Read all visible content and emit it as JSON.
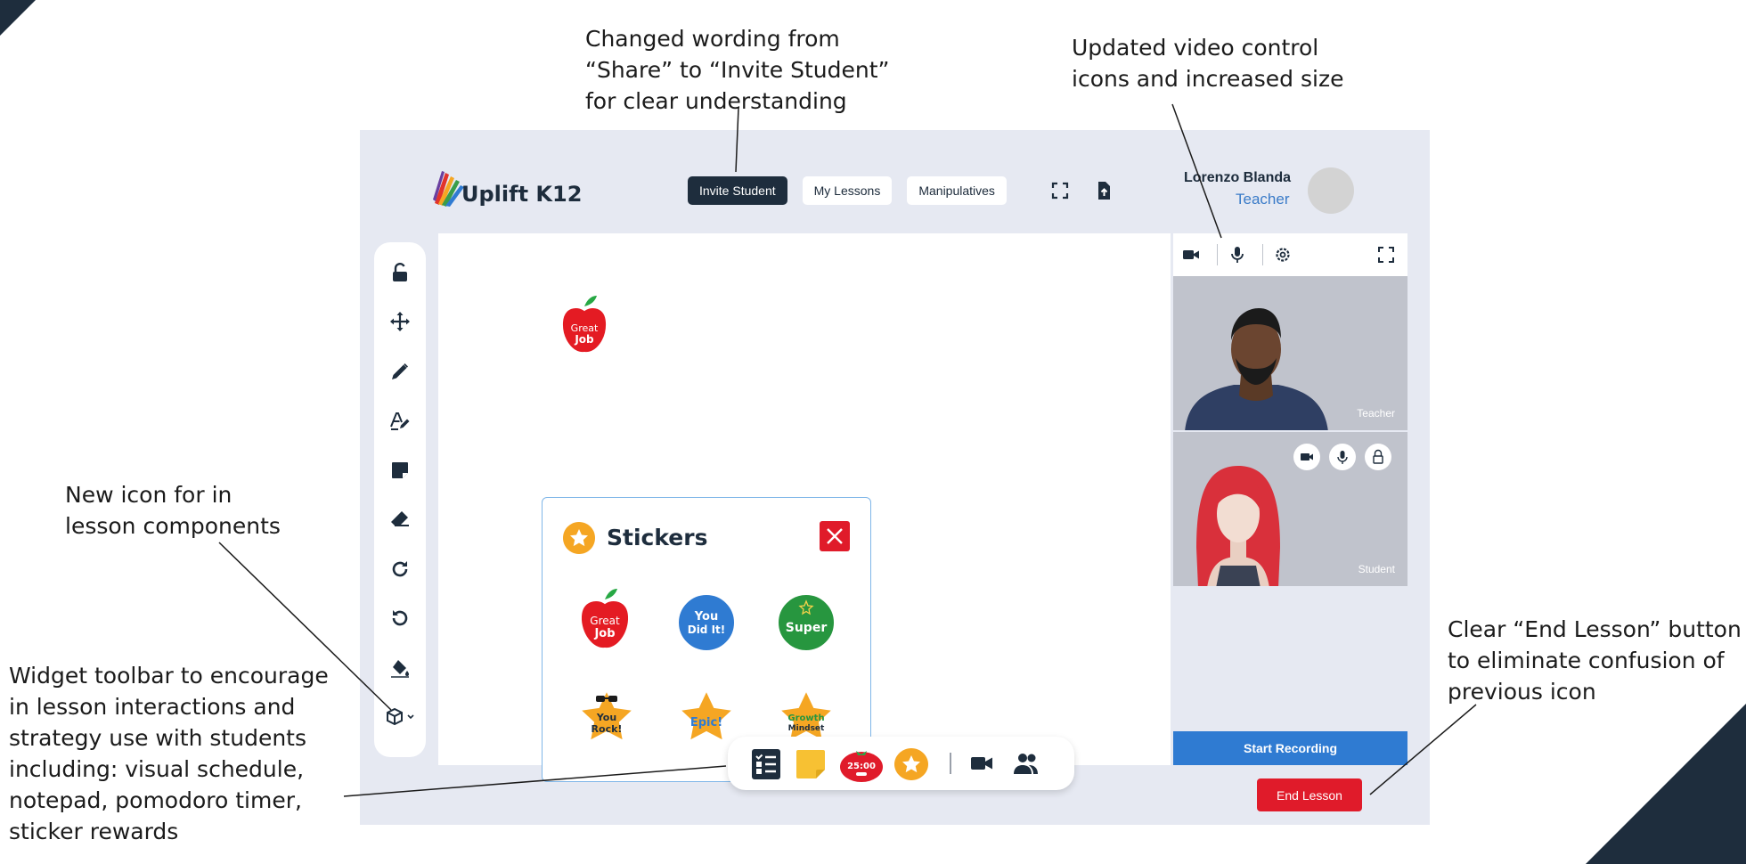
{
  "annotations": {
    "wording": "Changed wording from\n“Share” to “Invite Student”\nfor clear understanding",
    "video_controls": "Updated video control\nicons and increased size",
    "lesson_components": "New icon for in\nlesson components",
    "widget_toolbar": "Widget toolbar to encourage\nin lesson interactions and\nstrategy use with students\nincluding: visual schedule,\nnotepad, pomodoro timer,\nsticker rewards",
    "end_lesson": "Clear “End Lesson” button\nto eliminate confusion of\nprevious icon"
  },
  "app": {
    "logo_text": "Uplift K12",
    "nav": [
      "Invite Student",
      "My Lessons",
      "Manipulatives"
    ],
    "user": {
      "name": "Lorenzo Blanda",
      "role": "Teacher"
    },
    "toolbar_icons": [
      "unlock-icon",
      "move-icon",
      "pencil-icon",
      "text-pen-icon",
      "sticky-note-icon",
      "eraser-icon",
      "redo-icon",
      "undo-icon",
      "paint-bucket-icon",
      "components-icon"
    ],
    "canvas_sticker": {
      "line1": "Great",
      "line2": "Job"
    },
    "stickers_panel": {
      "title": "Stickers",
      "items": [
        {
          "name": "great-job",
          "line1": "Great",
          "line2": "Job"
        },
        {
          "name": "you-did-it",
          "line1": "You",
          "line2": "Did It!"
        },
        {
          "name": "super",
          "line1": "Super",
          "line2": ""
        },
        {
          "name": "you-rock",
          "line1": "You",
          "line2": "Rock!"
        },
        {
          "name": "epic",
          "line1": "Epic!",
          "line2": ""
        },
        {
          "name": "growth-mindset",
          "line1": "Growth",
          "line2": "Mindset"
        }
      ]
    },
    "video": {
      "teacher_label": "Teacher",
      "student_label": "Student",
      "start_recording": "Start Recording"
    },
    "end_lesson": "End Lesson",
    "widgets": {
      "timer": "25:00"
    }
  },
  "colors": {
    "navy": "#1e2d3d",
    "accent_blue": "#2f7bd2",
    "red": "#e01b2a",
    "app_bg": "#e6e9f2",
    "orange": "#f5a623"
  }
}
